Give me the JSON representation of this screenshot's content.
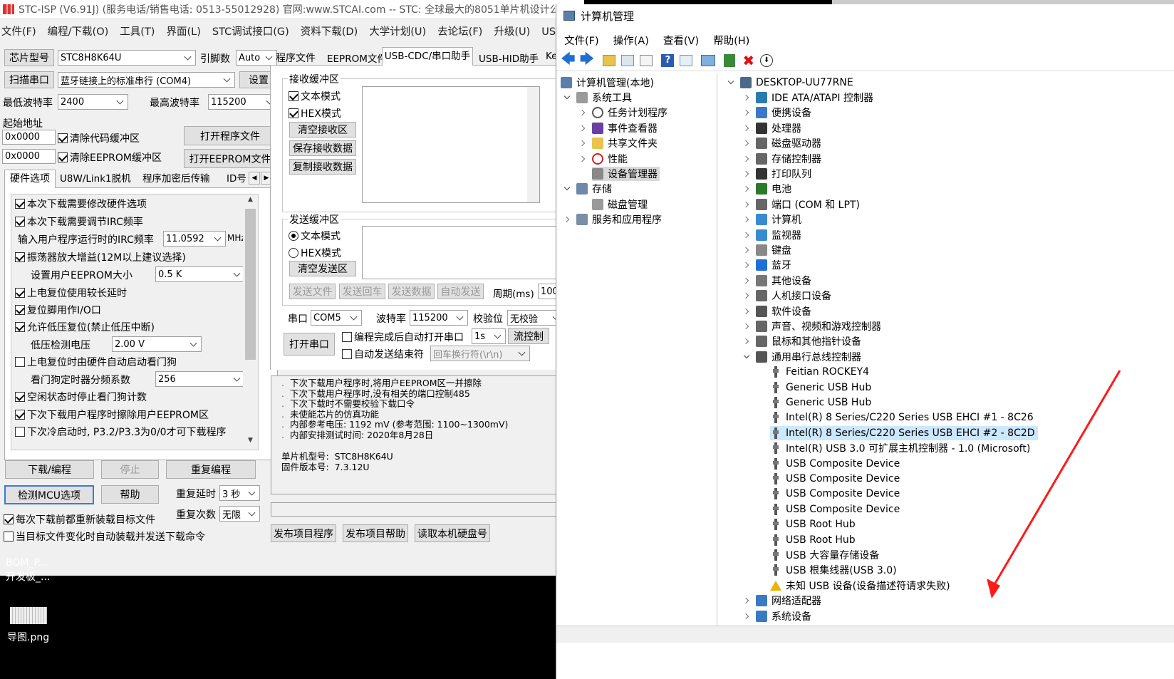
{
  "stc": {
    "title": "STC-ISP (V6.91J) (服务电话/销售电话: 0513-55012928) 官网:www.STCAI.com  -- STC: 全球最大的8051单片机设计公",
    "menu": [
      "文件(F)",
      "编程/下载(O)",
      "工具(T)",
      "界面(L)",
      "STC调试接口(G)",
      "资料下载(D)",
      "大学计划(U)",
      "去论坛(F)",
      "升级(U)",
      "USB驱"
    ],
    "chip_label": "芯片型号",
    "chip_value": "STC8H8K64U",
    "pin_label": "引脚数",
    "pin_value": "Auto",
    "scan_label": "扫描串口",
    "port_value": "蓝牙链接上的标准串行 (COM4)",
    "settings_label": "设置",
    "min_baud_label": "最低波特率",
    "min_baud_value": "2400",
    "max_baud_label": "最高波特率",
    "max_baud_value": "115200",
    "start_addr_label": "起始地址",
    "addr1": "0x0000",
    "clear_code_label": "清除代码缓冲区",
    "open_prog_label": "打开程序文件",
    "addr2": "0x0000",
    "clear_eeprom_label": "清除EEPROM缓冲区",
    "open_eeprom_label": "打开EEPROM文件",
    "left_tabs": [
      "硬件选项",
      "U8W/Link1脱机",
      "程序加密后传输",
      "ID号"
    ],
    "options": [
      {
        "label": "本次下载需要修改硬件选项",
        "checked": true
      },
      {
        "label": "本次下载需要调节IRC频率",
        "checked": true
      },
      {
        "label": "输入用户程序运行时的IRC频率",
        "value": "11.0592",
        "unit": "MHz"
      },
      {
        "label": "振荡器放大增益(12M以上建议选择)",
        "checked": true
      },
      {
        "label": "设置用户EEPROM大小",
        "value": "0.5 K"
      },
      {
        "label": "上电复位使用较长延时",
        "checked": true
      },
      {
        "label": "复位脚用作I/O口",
        "checked": true
      },
      {
        "label": "允许低压复位(禁止低压中断)",
        "checked": true
      },
      {
        "label": "低压检测电压",
        "value": "2.00 V"
      },
      {
        "label": "上电复位时由硬件自动启动看门狗",
        "checked": false
      },
      {
        "label": "看门狗定时器分频系数",
        "value": "256"
      },
      {
        "label": "空闲状态时停止看门狗计数",
        "checked": true
      },
      {
        "label": "下次下载用户程序时擦除用户EEPROM区",
        "checked": true
      },
      {
        "label": "下次冷启动时, P3.2/P3.3为0/0才可下载程序",
        "checked": false
      }
    ],
    "download_label": "下载/编程",
    "stop_label": "停止",
    "reprogram_label": "重复编程",
    "detect_label": "检测MCU选项",
    "help_label": "帮助",
    "repeat_delay_label": "重复延时",
    "repeat_delay_value": "3 秒",
    "repeat_count_label": "重复次数",
    "repeat_count_value": "无限",
    "reload_label": "每次下载前都重新装载目标文件",
    "auto_load_label": "当目标文件变化时自动装载并发送下载命令",
    "right_tabs": [
      "程序文件",
      "EEPROM文件",
      "USB-CDC/串口助手",
      "USB-HID助手",
      "Ke"
    ],
    "recv_title": "接收缓冲区",
    "text_mode": "文本模式",
    "hex_mode": "HEX模式",
    "clear_recv": "清空接收区",
    "save_recv": "保存接收数据",
    "copy_recv": "复制接收数据",
    "send_title": "发送缓冲区",
    "clear_send": "清空发送区",
    "send_file": "发送文件",
    "send_enter": "发送回车",
    "send_data": "发送数据",
    "auto_send": "自动发送",
    "period_label": "周期(ms)",
    "period_value": "100",
    "serial_label": "串口",
    "serial_value": "COM5",
    "baud_label": "波特率",
    "baud_value": "115200",
    "parity_label": "校验位",
    "parity_value": "无校验",
    "open_serial": "打开串口",
    "auto_open_label": "编程完成后自动打开串口",
    "auto_open_value": "1s",
    "flow_label": "流控制",
    "auto_end_label": "自动发送结束符",
    "end_value": "回车换行符(\\r\\n)",
    "log_lines": [
      "下次下载用户程序时,将用户EEPROM区一并擦除",
      "下次下载用户程序时,没有相关的端口控制485",
      "下次下载时不需要校验下载口令",
      "未使能芯片的仿真功能",
      "内部参考电压: 1192 mV (参考范围: 1100~1300mV)",
      "内部安排测试时间: 2020年8月28日"
    ],
    "mcu_model_label": "单片机型号:",
    "mcu_model_value": "STC8H8K64U",
    "fw_label": "固件版本号:",
    "fw_value": "7.3.12U",
    "publish_prog": "发布项目程序",
    "publish_help": "发布项目帮助",
    "read_disk": "读取本机硬盘号"
  },
  "desktop": {
    "file1": "BOM_P...",
    "file1b": "开发板_...",
    "file2": "导图.png"
  },
  "cm": {
    "title": "计算机管理",
    "menu": [
      "文件(F)",
      "操作(A)",
      "查看(V)",
      "帮助(H)"
    ],
    "left_tree": [
      {
        "label": "计算机管理(本地)",
        "level": 0,
        "icon": "computer-management-icon"
      },
      {
        "label": "系统工具",
        "level": 1,
        "icon": "tools-icon",
        "expanded": true
      },
      {
        "label": "任务计划程序",
        "level": 2,
        "icon": "clock-icon"
      },
      {
        "label": "事件查看器",
        "level": 2,
        "icon": "event-viewer-icon"
      },
      {
        "label": "共享文件夹",
        "level": 2,
        "icon": "shared-folder-icon"
      },
      {
        "label": "性能",
        "level": 2,
        "icon": "performance-icon"
      },
      {
        "label": "设备管理器",
        "level": 2,
        "icon": "device-manager-icon",
        "selected": true
      },
      {
        "label": "存储",
        "level": 1,
        "icon": "storage-icon",
        "expanded": true
      },
      {
        "label": "磁盘管理",
        "level": 2,
        "icon": "disk-icon"
      },
      {
        "label": "服务和应用程序",
        "level": 1,
        "icon": "services-icon"
      }
    ],
    "root": "DESKTOP-UU77RNE",
    "devices": [
      "IDE ATA/ATAPI 控制器",
      "便携设备",
      "处理器",
      "磁盘驱动器",
      "存储控制器",
      "打印队列",
      "电池",
      "端口 (COM 和 LPT)",
      "计算机",
      "监视器",
      "键盘",
      "蓝牙",
      "其他设备",
      "人机接口设备",
      "软件设备",
      "声音、视频和游戏控制器",
      "鼠标和其他指针设备",
      "通用串行总线控制器"
    ],
    "usb_children": [
      "Feitian ROCKEY4",
      "Generic USB Hub",
      "Generic USB Hub",
      "Intel(R) 8 Series/C220 Series USB EHCI #1 - 8C26",
      "Intel(R) 8 Series/C220 Series USB EHCI #2 - 8C2D",
      "Intel(R) USB 3.0 可扩展主机控制器 - 1.0 (Microsoft)",
      "USB Composite Device",
      "USB Composite Device",
      "USB Composite Device",
      "USB Composite Device",
      "USB Root Hub",
      "USB Root Hub",
      "USB 大容量存储设备",
      "USB 根集线器(USB 3.0)",
      "未知 USB 设备(设备描述符请求失败)"
    ],
    "after_devices": [
      "网络适配器",
      "系统设备"
    ],
    "colors": {
      "selected": "#cce8ff",
      "arrow": "#ff1a1a"
    }
  }
}
